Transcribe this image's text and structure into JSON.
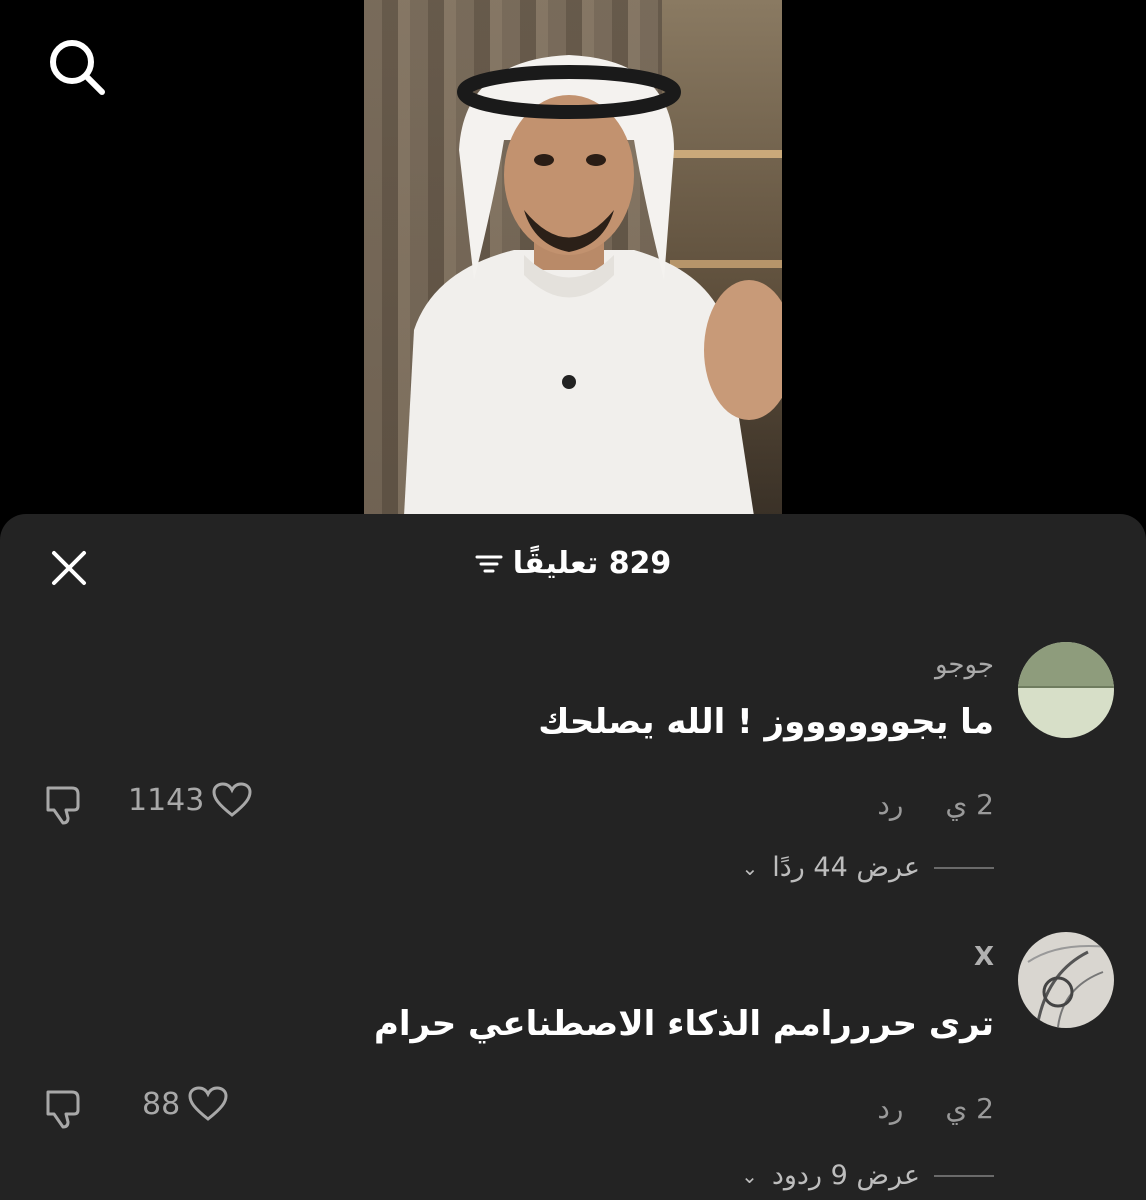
{
  "header": {
    "comments_title": "829 تعليقًا"
  },
  "comments": [
    {
      "username": "جوجو",
      "text": "ما يجووووووز ! الله يصلحك",
      "time": "2 ي",
      "reply_label": "رد",
      "likes": "1143",
      "view_replies": "عرض 44 ردًا"
    },
    {
      "username": "X",
      "text": "ترى حرررامم الذكاء الاصطناعي حرام",
      "time": "2 ي",
      "reply_label": "رد",
      "likes": "88",
      "view_replies": "عرض 9 ردود"
    }
  ],
  "icons": {
    "search": "search-icon",
    "close": "close-icon",
    "filter": "filter-icon",
    "like": "heart-icon",
    "dislike": "thumbs-down-icon",
    "chevron": "chevron-down-icon"
  }
}
